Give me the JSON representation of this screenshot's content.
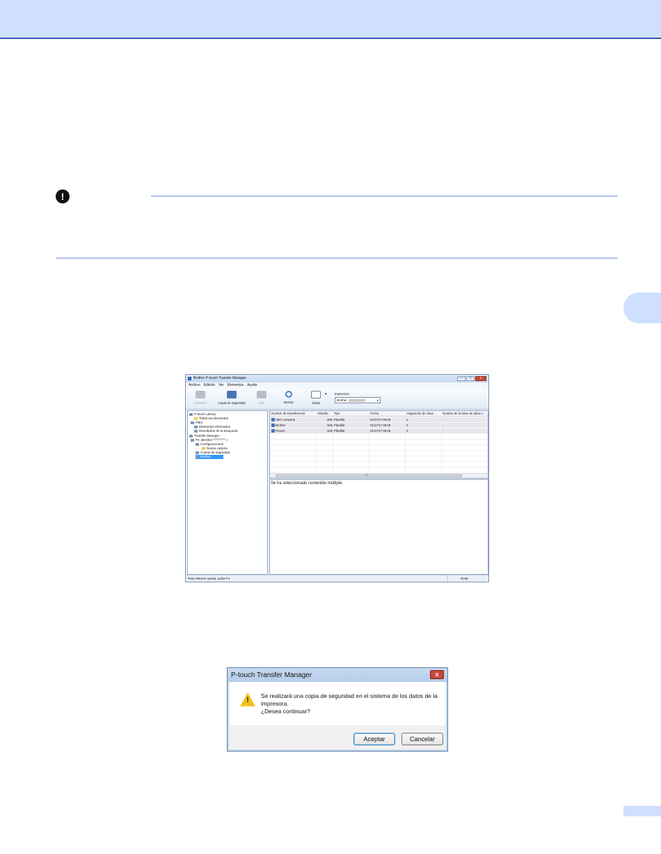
{
  "main_window": {
    "title": "Brother  P-touch Transfer Manager",
    "controls": {
      "minimize": "—",
      "maximize": "□",
      "close": "x"
    },
    "menu": [
      "Archivo",
      "Edición",
      "Ver",
      "Elementos",
      "Ayuda"
    ],
    "toolbar": {
      "transfer": "Transferir",
      "backup": "Copia de seguridad",
      "open": "Abrir",
      "search": "Buscar",
      "views": "Vistas",
      "printer_label": "Impresora:",
      "printer_value": "Brother",
      "views_arrow": "▾",
      "printer_arrow": "▾"
    },
    "tree": {
      "library": "P-touch Library",
      "all_items": "Todos los elementos",
      "filter": "Filtro",
      "deleted": "Elementos eliminados",
      "search_results": "Resultados de la búsqueda",
      "transfer_manager": "Transfer Manager",
      "pc": "PC (Brother",
      "pc_suffix": ")",
      "configurations": "Configuraciones",
      "new_folder": "Nueva carpeta",
      "backups": "Copias de seguridad",
      "device": "Brother"
    },
    "list": {
      "headers": [
        "Nombre de transferencia",
        "Tamaño",
        "Tipo",
        "Fecha",
        "Asignación de clave",
        "Nombre de la base de datos v"
      ],
      "rows": [
        [
          "ABC company",
          "1KB",
          "Plantilla",
          "01/17/17 09:29",
          "1",
          "-"
        ],
        [
          "Brother",
          "1KB",
          "Plantilla",
          "01/17/17 09:29",
          "2",
          "-"
        ],
        [
          "Ptouch",
          "1KB",
          "Plantilla",
          "01/17/17 09:29",
          "3",
          "-"
        ]
      ],
      "scroll_grip": "III"
    },
    "preview_text": "Se ha seleccionado contenido múltiple.",
    "status": {
      "help": "Para obtener ayuda, pulse F1",
      "num": "NUM"
    }
  },
  "dialog": {
    "title": "P-touch Transfer Manager",
    "close": "x",
    "warning_mark": "!",
    "message_line1": "Se realizará una copia de seguridad en el sistema de los datos de la",
    "message_line2": "impresora.",
    "message_line3": "¿Desea continuar?",
    "ok": "Aceptar",
    "cancel": "Cancelar"
  },
  "note_icon": "!",
  "colors": {
    "band": "#cfe0ff",
    "band_border": "#2e55b8",
    "rule": "#6f8fd6",
    "selection": "#3399ff"
  }
}
